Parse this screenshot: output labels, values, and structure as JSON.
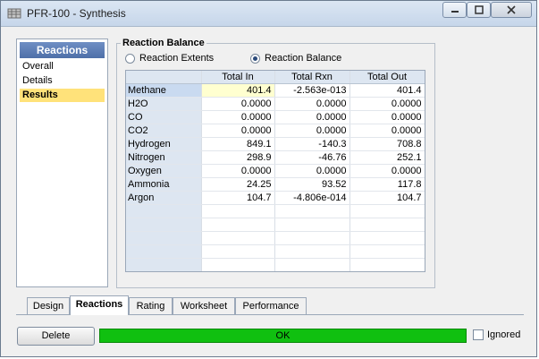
{
  "window": {
    "title": "PFR-100 - Synthesis"
  },
  "sidebar": {
    "header": "Reactions",
    "items": [
      {
        "label": "Overall"
      },
      {
        "label": "Details"
      },
      {
        "label": "Results"
      }
    ],
    "selected": "Results"
  },
  "panel": {
    "group_title": "Reaction Balance",
    "radio_extents": "Reaction Extents",
    "radio_balance": "Reaction Balance",
    "selected_radio": "Reaction Balance"
  },
  "table": {
    "columns": [
      "",
      "Total In",
      "Total Rxn",
      "Total Out"
    ],
    "rows": [
      {
        "name": "Methane",
        "total_in": "401.4",
        "total_rxn": "-2.563e-013",
        "total_out": "401.4"
      },
      {
        "name": "H2O",
        "total_in": "0.0000",
        "total_rxn": "0.0000",
        "total_out": "0.0000"
      },
      {
        "name": "CO",
        "total_in": "0.0000",
        "total_rxn": "0.0000",
        "total_out": "0.0000"
      },
      {
        "name": "CO2",
        "total_in": "0.0000",
        "total_rxn": "0.0000",
        "total_out": "0.0000"
      },
      {
        "name": "Hydrogen",
        "total_in": "849.1",
        "total_rxn": "-140.3",
        "total_out": "708.8"
      },
      {
        "name": "Nitrogen",
        "total_in": "298.9",
        "total_rxn": "-46.76",
        "total_out": "252.1"
      },
      {
        "name": "Oxygen",
        "total_in": "0.0000",
        "total_rxn": "0.0000",
        "total_out": "0.0000"
      },
      {
        "name": "Ammonia",
        "total_in": "24.25",
        "total_rxn": "93.52",
        "total_out": "117.8"
      },
      {
        "name": "Argon",
        "total_in": "104.7",
        "total_rxn": "-4.806e-014",
        "total_out": "104.7"
      }
    ]
  },
  "tabs": [
    {
      "label": "Design"
    },
    {
      "label": "Reactions"
    },
    {
      "label": "Rating"
    },
    {
      "label": "Worksheet"
    },
    {
      "label": "Performance"
    }
  ],
  "active_tab": "Reactions",
  "footer": {
    "delete_label": "Delete",
    "status_text": "OK",
    "status_color": "#10c010",
    "ignored_label": "Ignored",
    "ignored_checked": false
  },
  "icons": {
    "app": "grid-app-icon",
    "minimize": "minimize-icon",
    "maximize": "maximize-icon",
    "close": "close-icon"
  }
}
